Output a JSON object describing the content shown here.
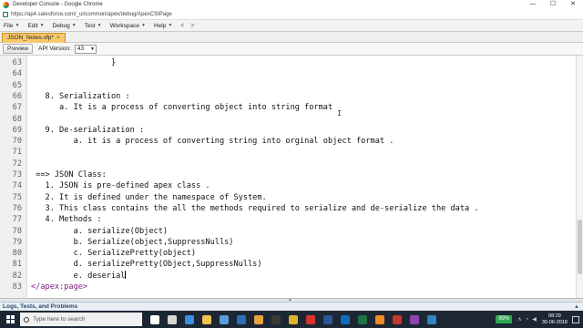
{
  "window": {
    "title": "Developer Console - Google Chrome",
    "controls": [
      "—",
      "☐",
      "✕"
    ]
  },
  "browser": {
    "url": "https://ap4.salesforce.com/_ui/common/apex/debug/ApexCSIPage"
  },
  "menubar": {
    "items": [
      "File",
      "Edit",
      "Debug",
      "Test",
      "Workspace",
      "Help"
    ],
    "back": "<",
    "forward": ">"
  },
  "tab": {
    "label": "JSON_Notes.vfp",
    "modified_marker": "*",
    "close": "×"
  },
  "toolbar": {
    "preview_label": "Preview",
    "api_label": "API Version:",
    "api_value": "43"
  },
  "editor": {
    "lines": [
      {
        "num": "63",
        "text": "                 }"
      },
      {
        "num": "64",
        "text": ""
      },
      {
        "num": "65",
        "text": ""
      },
      {
        "num": "66",
        "text": "   8. Serialization :"
      },
      {
        "num": "67",
        "text": "      a. It is a process of converting object into string format"
      },
      {
        "num": "68",
        "text": ""
      },
      {
        "num": "69",
        "text": "   9. De-serialization :"
      },
      {
        "num": "70",
        "text": "         a. it is a process of converting string into orginal object format ."
      },
      {
        "num": "71",
        "text": ""
      },
      {
        "num": "72",
        "text": ""
      },
      {
        "num": "73",
        "text": " ==> JSON Class:"
      },
      {
        "num": "74",
        "text": "   1. JSON is pre-defined apex class ."
      },
      {
        "num": "75",
        "text": "   2. It is defined under the namespace of System."
      },
      {
        "num": "76",
        "text": "   3. This class contains the all the methods required to serialize and de-serialize the data ."
      },
      {
        "num": "77",
        "text": "   4. Methods :"
      },
      {
        "num": "78",
        "text": "         a. serialize(Object)"
      },
      {
        "num": "79",
        "text": "         b. Serialize(object,SuppressNulls)"
      },
      {
        "num": "80",
        "text": "         c. SerializePretty(object)"
      },
      {
        "num": "81",
        "text": "         d. serializePretty(Object,SuppressNulls)"
      },
      {
        "num": "82",
        "text": "         e. deserial"
      },
      {
        "num": "83",
        "text": "</apex:page>"
      }
    ]
  },
  "bottom_panel": {
    "label": "Logs, Tests, and Problems"
  },
  "taskbar": {
    "search_placeholder": "Type here to search",
    "battery": "99%",
    "time": "08:29",
    "date": "30-06-2018",
    "icons": [
      {
        "name": "cortana-icon",
        "color": "#ffffff"
      },
      {
        "name": "task-view-icon",
        "color": "#d8d8d8"
      },
      {
        "name": "edge-icon",
        "color": "#3c8fe0"
      },
      {
        "name": "file-explorer-icon",
        "color": "#f2c14e"
      },
      {
        "name": "store-icon",
        "color": "#5b9bd5"
      },
      {
        "name": "photoshop-icon",
        "color": "#2a6fb8"
      },
      {
        "name": "paint-icon",
        "color": "#e8a23c"
      },
      {
        "name": "camera-icon",
        "color": "#3a3a3a"
      },
      {
        "name": "chrome-icon",
        "color": "#e0b030"
      },
      {
        "name": "opera-icon",
        "color": "#d9322e"
      },
      {
        "name": "word-icon",
        "color": "#2b5797"
      },
      {
        "name": "outlook-icon",
        "color": "#0f6cbd"
      },
      {
        "name": "excel-icon",
        "color": "#1f7244"
      },
      {
        "name": "vlc-icon",
        "color": "#f08a24"
      },
      {
        "name": "screen-recorder-icon",
        "color": "#c0392b"
      },
      {
        "name": "app-icon",
        "color": "#8e44ad"
      },
      {
        "name": "app2-icon",
        "color": "#2e86c1"
      }
    ]
  }
}
